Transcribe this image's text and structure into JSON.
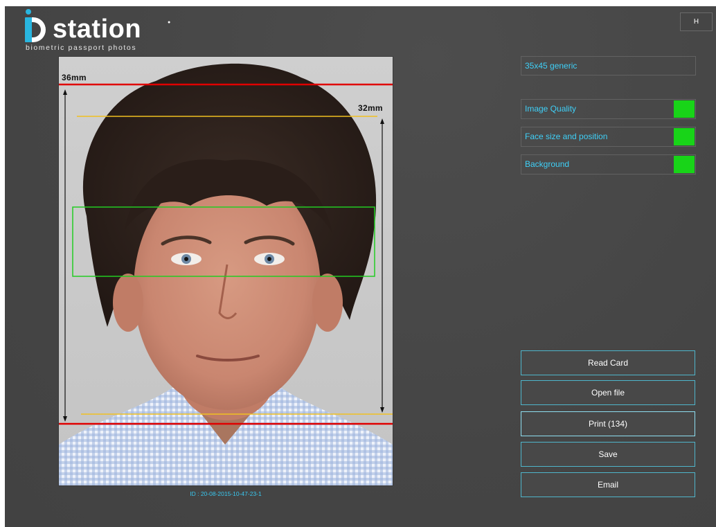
{
  "brand": {
    "name": "station",
    "tagline": "biometric passport photos",
    "accent_color": "#29b6e0"
  },
  "header": {
    "h_button_label": "H"
  },
  "photo": {
    "width_label": "36mm",
    "height_label": "32mm",
    "id_text": "ID : 20-08-2015-10-47-23-1",
    "guide_colors": {
      "outer": "#e00000",
      "inner": "#f0c020",
      "eyes": "#22cc22"
    }
  },
  "panel": {
    "format": "35x45 generic",
    "checks": [
      {
        "label": "Image Quality",
        "status_color": "#18d418"
      },
      {
        "label": "Face size and position",
        "status_color": "#18d418"
      },
      {
        "label": "Background",
        "status_color": "#18d418"
      }
    ],
    "actions": [
      {
        "label": "Read Card"
      },
      {
        "label": "Open file"
      },
      {
        "label": "Print  (134)"
      },
      {
        "label": "Save"
      },
      {
        "label": "Email"
      }
    ]
  }
}
